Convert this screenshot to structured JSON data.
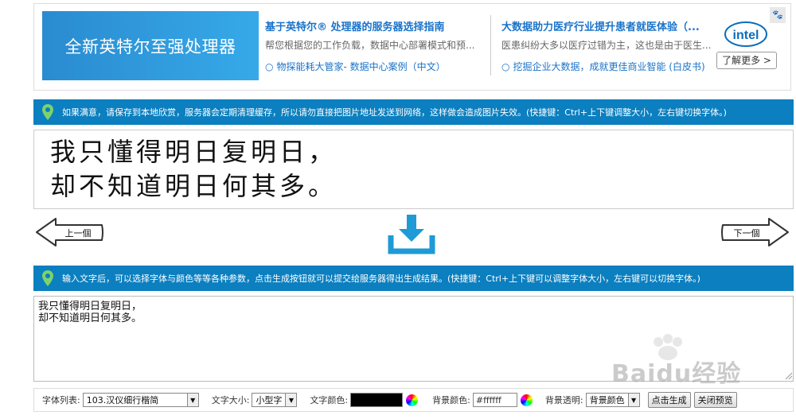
{
  "ad": {
    "banner_text": "全新英特尔至强处理器",
    "col1": {
      "title": "基于英特尔® 处理器的服务器选择指南",
      "desc": "帮您根据您的工作负载，数据中心部署模式和预...",
      "link": "物探能耗大管家- 数据中心案例（中文）"
    },
    "col2": {
      "title": "大数据助力医疗行业提升患者就医体验（...",
      "desc": "医患纠纷大多以医疗过错为主，这也是由于医生...",
      "link": "挖掘企业大数据，成就更佳商业智能 (白皮书)"
    },
    "brand": "intel",
    "more_label": "了解更多 >"
  },
  "notice_top": "如果满意，请保存到本地欣赏，服务器会定期清理缓存，所以请勿直接把图片地址发送到网络，这样做会造成图片失效。(快捷键：Ctrl+上下键调整大小，左右键切换字体。)",
  "preview": {
    "line1": "我只懂得明日复明日，",
    "line2": "却不知道明日何其多。"
  },
  "nav": {
    "prev_label": "上一個",
    "next_label": "下一個"
  },
  "notice_bottom": "输入文字后，可以选择字体与颜色等等各种参数，点击生成按钮就可以提交给服务器得出生成结果。(快捷键：Ctrl+上下键可以调整字体大小，左右键可以切换字体。)",
  "input_text": "我只懂得明日复明日，\n却不知道明日何其多。",
  "watermark": "Baidu经验",
  "controls": {
    "font_list_label": "字体列表:",
    "font_value": "103.汉仪细行楷简",
    "size_label": "文字大小:",
    "size_value": "小型字",
    "text_color_label": "文字颜色:",
    "text_color": "#000000",
    "bg_color_label": "背景颜色:",
    "bg_color_value": "#ffffff",
    "bg_transparent_label": "背景透明:",
    "bg_transparent_value": "背景颜色",
    "generate_label": "点击生成",
    "close_preview_label": "关闭预览"
  },
  "colors": {
    "accent": "#0b7fbf",
    "link": "#1a73c9",
    "download": "#1e9ad6"
  }
}
